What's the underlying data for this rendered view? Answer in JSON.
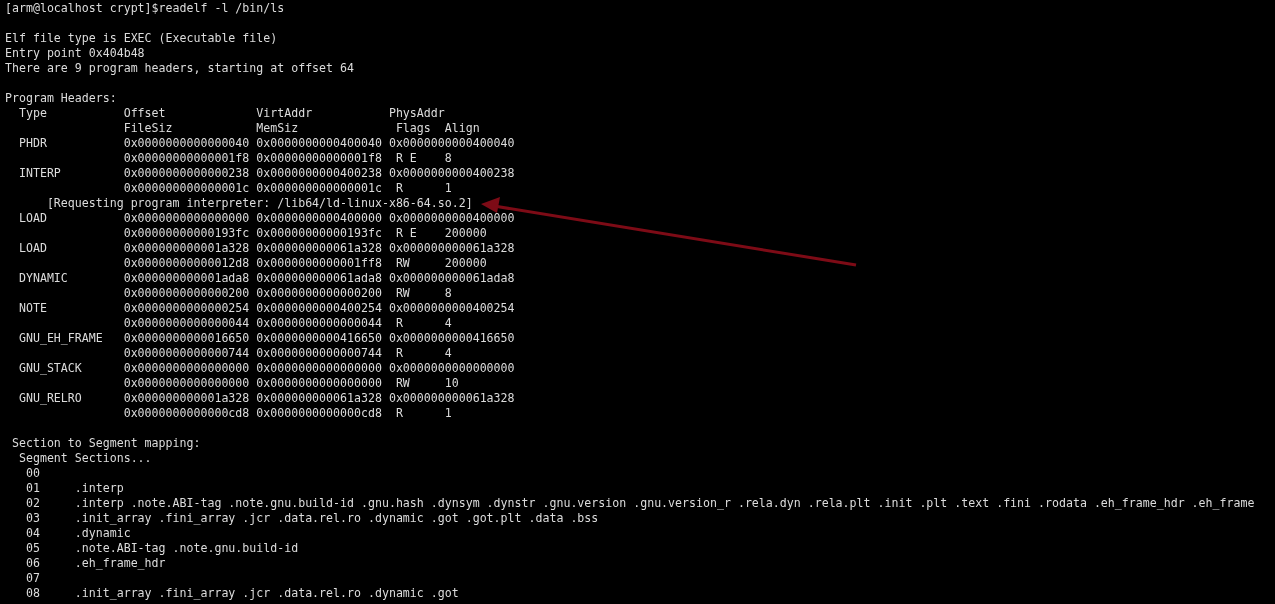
{
  "terminal": {
    "blocks": [
      {
        "lines": [
          "[arm@localhost crypt]$readelf -l /bin/ls"
        ]
      },
      {
        "lines": [
          "Elf file type is EXEC (Executable file)",
          "Entry point 0x404b48",
          "There are 9 program headers, starting at offset 64"
        ]
      },
      {
        "lines": [
          "Program Headers:",
          "  Type           Offset             VirtAddr           PhysAddr",
          "                 FileSiz            MemSiz              Flags  Align",
          "  PHDR           0x0000000000000040 0x0000000000400040 0x0000000000400040",
          "                 0x00000000000001f8 0x00000000000001f8  R E    8",
          "  INTERP         0x0000000000000238 0x0000000000400238 0x0000000000400238",
          "                 0x000000000000001c 0x000000000000001c  R      1",
          "      [Requesting program interpreter: /lib64/ld-linux-x86-64.so.2]",
          "  LOAD           0x0000000000000000 0x0000000000400000 0x0000000000400000",
          "                 0x00000000000193fc 0x00000000000193fc  R E    200000",
          "  LOAD           0x000000000001a328 0x000000000061a328 0x000000000061a328",
          "                 0x00000000000012d8 0x0000000000001ff8  RW     200000",
          "  DYNAMIC        0x000000000001ada8 0x000000000061ada8 0x000000000061ada8",
          "                 0x0000000000000200 0x0000000000000200  RW     8",
          "  NOTE           0x0000000000000254 0x0000000000400254 0x0000000000400254",
          "                 0x0000000000000044 0x0000000000000044  R      4",
          "  GNU_EH_FRAME   0x0000000000016650 0x0000000000416650 0x0000000000416650",
          "                 0x0000000000000744 0x0000000000000744  R      4",
          "  GNU_STACK      0x0000000000000000 0x0000000000000000 0x0000000000000000",
          "                 0x0000000000000000 0x0000000000000000  RW     10",
          "  GNU_RELRO      0x000000000001a328 0x000000000061a328 0x000000000061a328",
          "                 0x0000000000000cd8 0x0000000000000cd8  R      1"
        ]
      },
      {
        "lines": [
          " Section to Segment mapping:",
          "  Segment Sections...",
          "   00",
          "   01     .interp",
          "   02     .interp .note.ABI-tag .note.gnu.build-id .gnu.hash .dynsym .dynstr .gnu.version .gnu.version_r .rela.dyn .rela.plt .init .plt .text .fini .rodata .eh_frame_hdr .eh_frame",
          "   03     .init_array .fini_array .jcr .data.rel.ro .dynamic .got .got.plt .data .bss",
          "   04     .dynamic",
          "   05     .note.ABI-tag .note.gnu.build-id",
          "   06     .eh_frame_hdr",
          "   07",
          "   08     .init_array .fini_array .jcr .data.rel.ro .dynamic .got"
        ]
      }
    ]
  }
}
